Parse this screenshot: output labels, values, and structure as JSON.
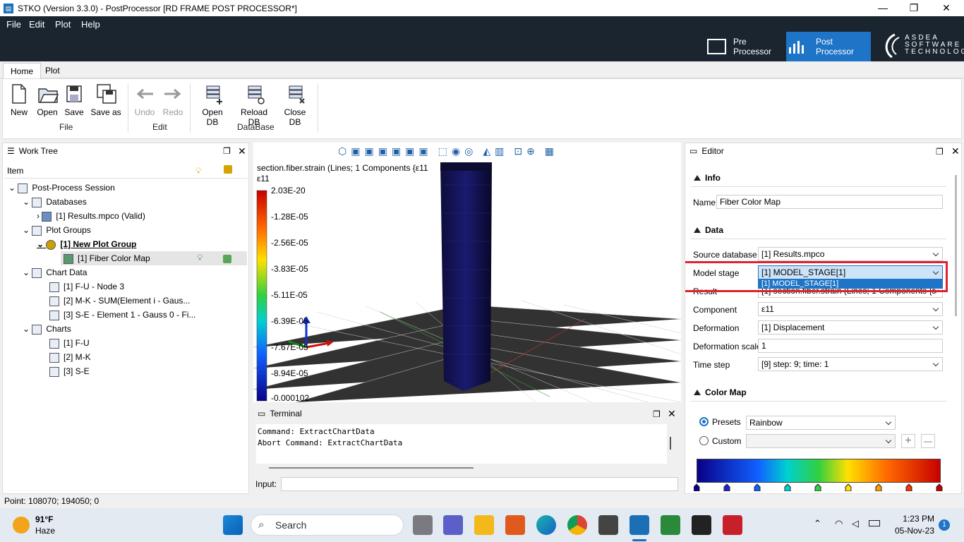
{
  "window": {
    "title": "STKO (Version 3.3.0) - PostProcessor [RD FRAME POST PROCESSOR*]",
    "minimize": "—",
    "restore": "❐",
    "close": "✕"
  },
  "menu": [
    "File",
    "Edit",
    "Plot",
    "Help"
  ],
  "modes": {
    "pre": "Pre Processor",
    "post": "Post Processor",
    "logo_line1": "ASDEA",
    "logo_line2": "SOFTWARE",
    "logo_line3": "TECHNOLOGY"
  },
  "ribbon_tabs": [
    "Home",
    "Plot"
  ],
  "ribbon": {
    "new": "New",
    "open": "Open",
    "save": "Save",
    "saveas": "Save as",
    "file_group": "File",
    "undo": "Undo",
    "redo": "Redo",
    "edit_group": "Edit",
    "opendb": "Open DB",
    "reloaddb": "Reload DB",
    "closedb": "Close DB",
    "db_group": "DataBase"
  },
  "worktree": {
    "title": "Work Tree",
    "col": "Item",
    "items": [
      "Post-Process Session",
      "Databases",
      "[1] Results.mpco (Valid)",
      "Plot Groups",
      "[1] New Plot Group",
      "[1] Fiber Color Map",
      "Chart Data",
      "[1] F-U - Node 3",
      "[2] M-K - SUM(Element i - Gaus...",
      "[3] S-E - Element 1 - Gauss 0 - Fi...",
      "Charts",
      "[1] F-U",
      "[2] M-K",
      "[3] S-E"
    ]
  },
  "viewport": {
    "title": "section.fiber.strain (Lines; 1 Components {ε11",
    "component": "ε11",
    "legend": [
      "2.03E-20",
      "-1.28E-05",
      "-2.56E-05",
      "-3.83E-05",
      "-5.11E-05",
      "-6.39E-05",
      "-7.67E-05",
      "-8.94E-05",
      "-0.000102"
    ]
  },
  "terminal": {
    "title": "Terminal",
    "lines": [
      "Command: ExtractChartData",
      "Abort Command: ExtractChartData"
    ],
    "input_label": "Input:"
  },
  "editor": {
    "title": "Editor",
    "info": "Info",
    "name_label": "Name",
    "name_value": "Fiber Color Map",
    "data": "Data",
    "source_label": "Source database",
    "source_value": "[1] Results.mpco",
    "stage_label": "Model stage",
    "stage_value": "[1] MODEL_STAGE[1]",
    "stage_option": "[1] MODEL_STAGE[1]",
    "result_label": "Result",
    "result_value": "[1] section.fiber.strain (Lines; 1 Components {ε",
    "component_label": "Component",
    "component_value": "ε11",
    "deformation_label": "Deformation",
    "deformation_value": "[1] Displacement",
    "defscale_label": "Deformation scale",
    "defscale_value": "1",
    "timestep_label": "Time step",
    "timestep_value": "[9] step: 9; time: 1",
    "colormap": "Color Map",
    "presets_label": "Presets",
    "presets_value": "Rainbow",
    "custom_label": "Custom",
    "plus": "+",
    "minus": "—"
  },
  "status": "Point: 108070; 194050; 0",
  "taskbar": {
    "temp": "91°F",
    "weather": "Haze",
    "search": "Search",
    "time": "1:23 PM",
    "date": "05-Nov-23",
    "badge": "1"
  },
  "colors": {
    "accent": "#1e74c6",
    "highlight": "#e0222e",
    "menubar": "#1b2530"
  }
}
